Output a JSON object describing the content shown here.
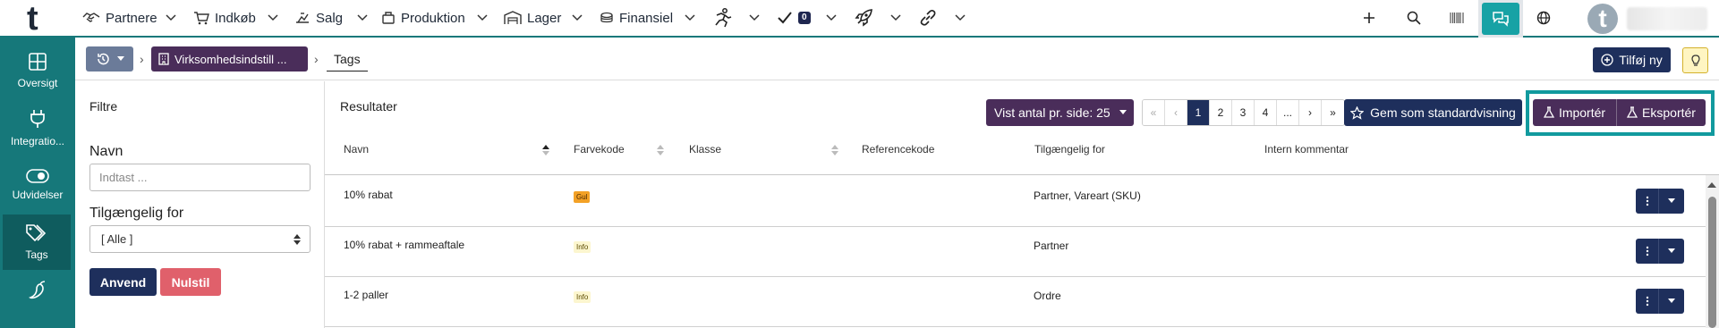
{
  "topbar": {
    "logo": "t",
    "nav": [
      {
        "label": "Partnere",
        "icon": "handshake-icon"
      },
      {
        "label": "Indkøb",
        "icon": "cart-icon"
      },
      {
        "label": "Salg",
        "icon": "sales-icon"
      },
      {
        "label": "Produktion",
        "icon": "production-icon"
      },
      {
        "label": "Lager",
        "icon": "warehouse-icon"
      },
      {
        "label": "Finansiel",
        "icon": "coins-icon"
      }
    ],
    "tasks_badge": "0",
    "avatar_letter": "t"
  },
  "sidebar": {
    "items": [
      {
        "label": "Oversigt",
        "icon": "grid-icon"
      },
      {
        "label": "Integratio...",
        "icon": "plug-icon"
      },
      {
        "label": "Udvidelser",
        "icon": "toggle-icon"
      },
      {
        "label": "Tags",
        "icon": "tags-icon"
      },
      {
        "label": "",
        "icon": "pepper-icon"
      }
    ]
  },
  "breadcrumb": {
    "parent": "Virksomhedsindstill ...",
    "current": "Tags"
  },
  "header": {
    "add_label": "Tilføj ny",
    "help_label": "?"
  },
  "filters": {
    "title": "Filtre",
    "name_label": "Navn",
    "name_placeholder": "Indtast ...",
    "available_label": "Tilgængelig for",
    "available_value": "[ Alle ]",
    "apply_label": "Anvend",
    "reset_label": "Nulstil"
  },
  "results": {
    "title": "Resultater",
    "per_page_label": "Vist antal pr. side: 25",
    "pager": [
      "«",
      "‹",
      "1",
      "2",
      "3",
      "4",
      "...",
      "›",
      "»"
    ],
    "active_page": "1",
    "save_view_label": "Gem som standardvisning",
    "import_label": "Importér",
    "export_label": "Eksportér",
    "columns": [
      "Navn",
      "Farvekode",
      "Klasse",
      "Referencekode",
      "Tilgængelig for",
      "Intern kommentar"
    ],
    "rows": [
      {
        "name": "10% rabat",
        "color_tag": "Gul",
        "color_kind": "gul",
        "klasse": "",
        "reference": "",
        "available": "Partner, Vareart (SKU)",
        "comment": ""
      },
      {
        "name": "10% rabat + rammeaftale",
        "color_tag": "Info",
        "color_kind": "info",
        "klasse": "",
        "reference": "",
        "available": "Partner",
        "comment": ""
      },
      {
        "name": "1-2 paller",
        "color_tag": "Info",
        "color_kind": "info",
        "klasse": "",
        "reference": "",
        "available": "Ordre",
        "comment": ""
      }
    ]
  },
  "colors": {
    "primary": "#1e2f5c",
    "accent_purple": "#4a2d5a",
    "teal": "#16787a",
    "danger": "#e0606b"
  }
}
